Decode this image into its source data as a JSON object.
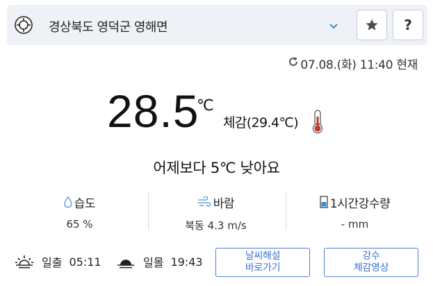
{
  "location": {
    "name": "경상북도 영덕군 영해면",
    "locate_icon": "target-icon",
    "dropdown_icon": "chevron-down-icon",
    "favorite_icon": "star-icon",
    "help_label": "?"
  },
  "update": {
    "text": "07.08.(화) 11:40 현재",
    "icon": "refresh-icon"
  },
  "current": {
    "temperature": "28.5",
    "unit": "℃",
    "feels_like": "체감(29.4℃)",
    "thermometer_icon": "thermometer-icon"
  },
  "comparison": "어제보다 5℃ 낮아요",
  "stats": [
    {
      "label": "습도",
      "value": "65 %",
      "icon": "droplet-icon"
    },
    {
      "label": "바람",
      "value": "북동 4.3 m/s",
      "icon": "wind-icon"
    },
    {
      "label": "1시간강수량",
      "value": "- mm",
      "icon": "rain-gauge-icon"
    }
  ],
  "sun": {
    "sunrise_label": "일출",
    "sunrise_time": "05:11",
    "sunset_label": "일몰",
    "sunset_time": "19:43"
  },
  "buttons": {
    "weather_explain_line1": "날씨해설",
    "weather_explain_line2": "바로가기",
    "rain_video_line1": "강수",
    "rain_video_line2": "체감영상"
  },
  "colors": {
    "accent": "#3b74cc",
    "bar_bg": "#eef1f6",
    "chevron": "#2f8fd8",
    "thermo_red": "#c0392b",
    "gauge_blue": "#2e8bd8"
  }
}
